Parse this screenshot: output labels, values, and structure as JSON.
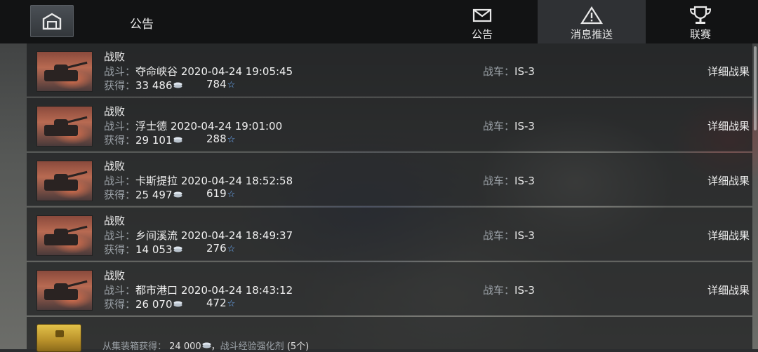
{
  "header": {
    "title": "公告",
    "tabs": [
      {
        "label": "公告",
        "icon": "envelope-icon",
        "active": false
      },
      {
        "label": "消息推送",
        "icon": "warning-icon",
        "active": true
      },
      {
        "label": "联赛",
        "icon": "trophy-icon",
        "active": false
      }
    ]
  },
  "labels": {
    "battle": "战斗：",
    "earned": "获得：",
    "tank": "战车：",
    "detail": "详细战果"
  },
  "battles": [
    {
      "result": "战败",
      "map": "夺命峡谷",
      "datetime": "2020-04-24 19:05:45",
      "credits": "33 486",
      "xp": "784",
      "tank": "IS-3"
    },
    {
      "result": "战败",
      "map": "浮士德",
      "datetime": "2020-04-24 19:01:00",
      "credits": "29 101",
      "xp": "288",
      "tank": "IS-3"
    },
    {
      "result": "战败",
      "map": "卡斯提拉",
      "datetime": "2020-04-24 18:52:58",
      "credits": "25 497",
      "xp": "619",
      "tank": "IS-3"
    },
    {
      "result": "战败",
      "map": "乡间溪流",
      "datetime": "2020-04-24 18:49:37",
      "credits": "14 053",
      "xp": "276",
      "tank": "IS-3"
    },
    {
      "result": "战败",
      "map": "都市港口",
      "datetime": "2020-04-24 18:43:12",
      "credits": "26 070",
      "xp": "472",
      "tank": "IS-3"
    }
  ],
  "bottom": {
    "prefix": "从集装箱获得：",
    "credits": "24 000",
    "separator": "，",
    "item": "战斗经验强化剂",
    "count": "(5个)"
  }
}
